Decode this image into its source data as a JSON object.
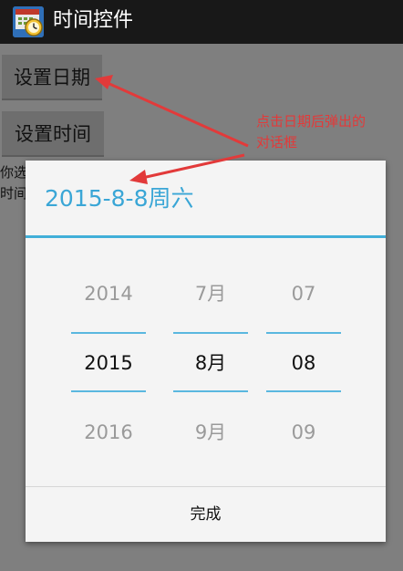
{
  "app": {
    "title": "时间控件",
    "icon": "app-clock-calendar-icon"
  },
  "buttons": {
    "set_date": "设置日期",
    "set_time": "设置时间"
  },
  "background_text": {
    "line1": "你选",
    "line2": "时间"
  },
  "annotation": {
    "line1": "点击日期后弹出的",
    "line2": "对话框",
    "color": "#e23a3a"
  },
  "dialog": {
    "title": "2015-8-8周六",
    "accent_color": "#3aa6d6",
    "pickers": {
      "year": {
        "prev": "2014",
        "current": "2015",
        "next": "2016"
      },
      "month": {
        "prev": "7月",
        "current": "8月",
        "next": "9月"
      },
      "day": {
        "prev": "07",
        "current": "08",
        "next": "09"
      }
    },
    "done_label": "完成"
  }
}
